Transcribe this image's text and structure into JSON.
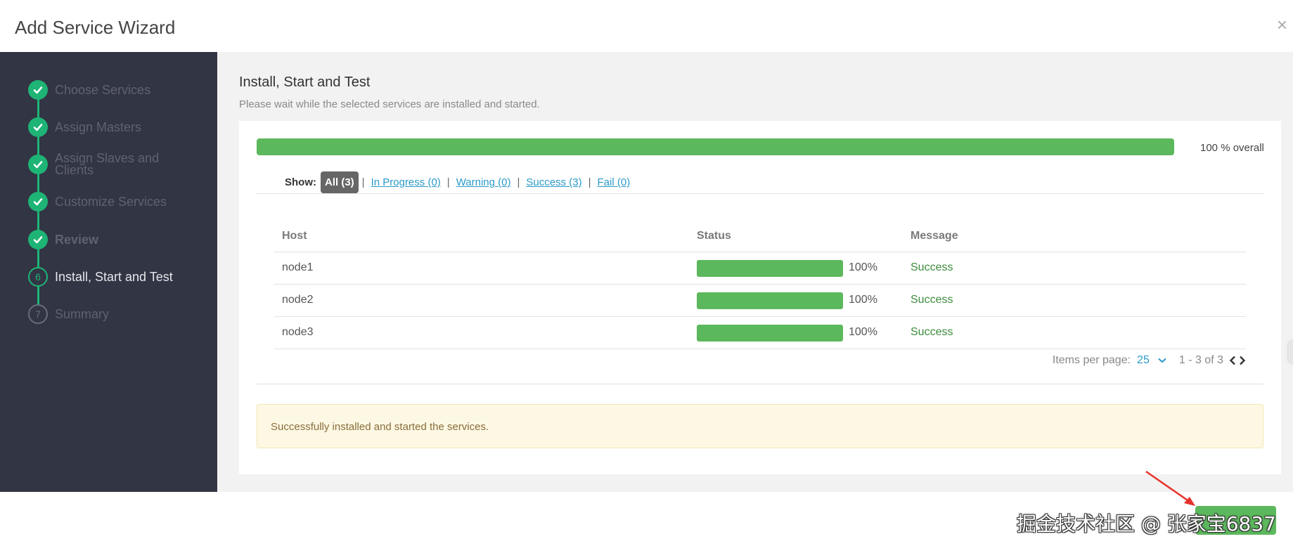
{
  "modal": {
    "title": "Add Service Wizard",
    "close_icon": "×"
  },
  "wizard_steps": [
    {
      "label": "Choose Services",
      "state": "done"
    },
    {
      "label": "Assign Masters",
      "state": "done"
    },
    {
      "label": "Assign Slaves and Clients",
      "state": "done"
    },
    {
      "label": "Customize Services",
      "state": "done"
    },
    {
      "label": "Review",
      "state": "done"
    },
    {
      "number": "6",
      "label": "Install, Start and Test",
      "state": "current"
    },
    {
      "number": "7",
      "label": "Summary",
      "state": "todo"
    }
  ],
  "main": {
    "title": "Install, Start and Test",
    "subtitle": "Please wait while the selected services are installed and started.",
    "overall_progress": 100,
    "overall_label": "100 % overall",
    "filter": {
      "show_label": "Show:",
      "all": "All (3)",
      "in_progress": "In Progress (0)",
      "warning": "Warning (0)",
      "success": "Success (3)",
      "fail": "Fail (0)",
      "separator": "|"
    },
    "table": {
      "headers": [
        "Host",
        "Status",
        "Message"
      ],
      "rows": [
        {
          "host": "node1",
          "progress": 100,
          "pct": "100%",
          "message": "Success"
        },
        {
          "host": "node2",
          "progress": 100,
          "pct": "100%",
          "message": "Success"
        },
        {
          "host": "node3",
          "progress": 100,
          "pct": "100%",
          "message": "Success"
        }
      ]
    },
    "pagination": {
      "items_per_page_label": "Items per page:",
      "items_per_page": "25",
      "range": "1 - 3 of 3"
    },
    "alert": "Successfully installed and started the services."
  },
  "footer": {
    "credit": "掘金技术社区 @ 张家宝6837"
  },
  "colors": {
    "sidebar_bg": "#323544",
    "step_done": "#1eb475",
    "progress": "#5cb85c",
    "link": "#2a9ac8",
    "alert_bg": "#fcf8e3",
    "annotation_arrow": "#e8322a"
  },
  "icons": {
    "step_done": "check-icon",
    "close": "close-icon",
    "dropdown": "chevron-down-icon",
    "prev": "chevron-left-icon",
    "next": "chevron-right-icon"
  }
}
